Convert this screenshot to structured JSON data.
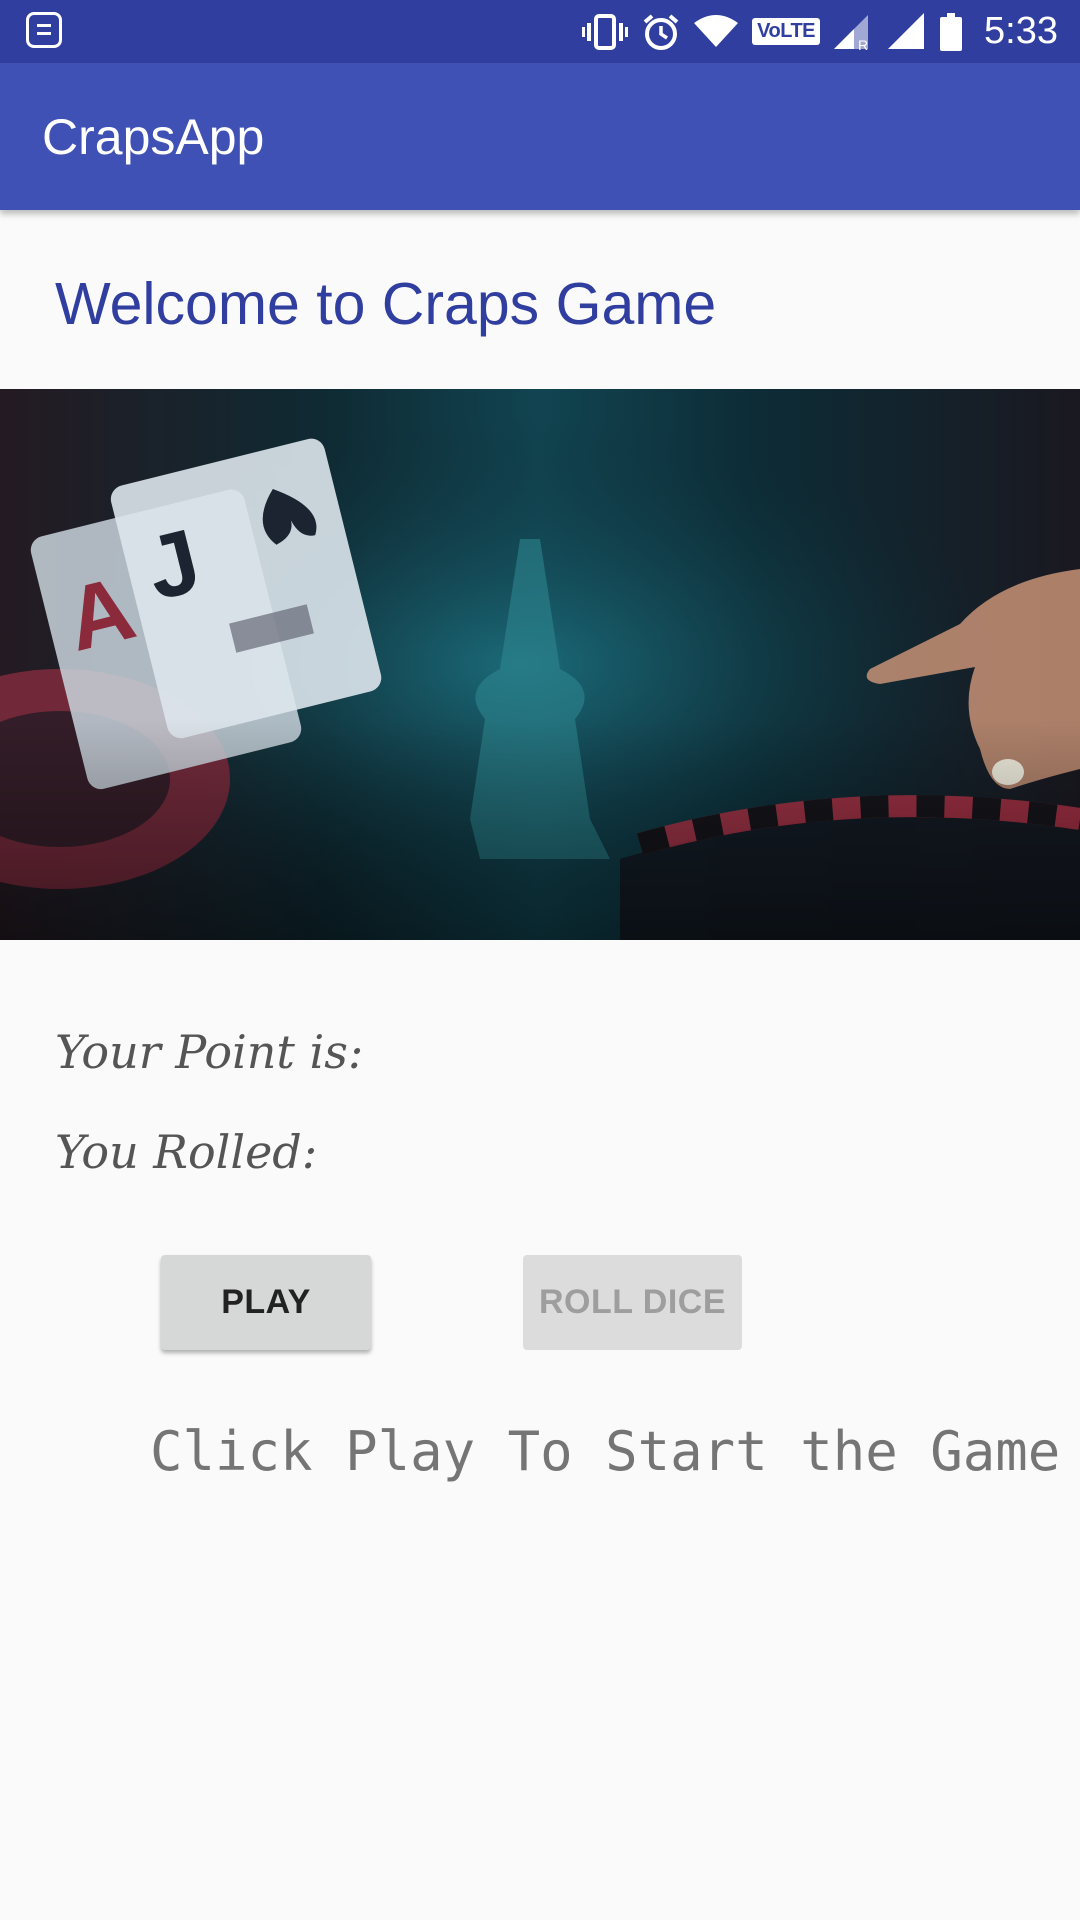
{
  "status_bar": {
    "time": "5:33",
    "volte_label": "VoLTE",
    "icons": [
      "notification-icon",
      "vibrate-icon",
      "alarm-icon",
      "wifi-icon",
      "volte-icon",
      "signal-roaming-icon",
      "signal-icon",
      "battery-icon"
    ]
  },
  "app_bar": {
    "title": "CrapsApp",
    "color": "#3f51b5"
  },
  "main": {
    "welcome_text": "Welcome to Craps Game",
    "point_label": "Your Point is:",
    "rolled_label": "You Rolled:",
    "play_button": "PLAY",
    "roll_dice_button": "ROLL DICE",
    "message": "Click Play To Start the Game"
  },
  "colors": {
    "status_bar": "#303f9f",
    "accent_text": "#303f9f"
  }
}
